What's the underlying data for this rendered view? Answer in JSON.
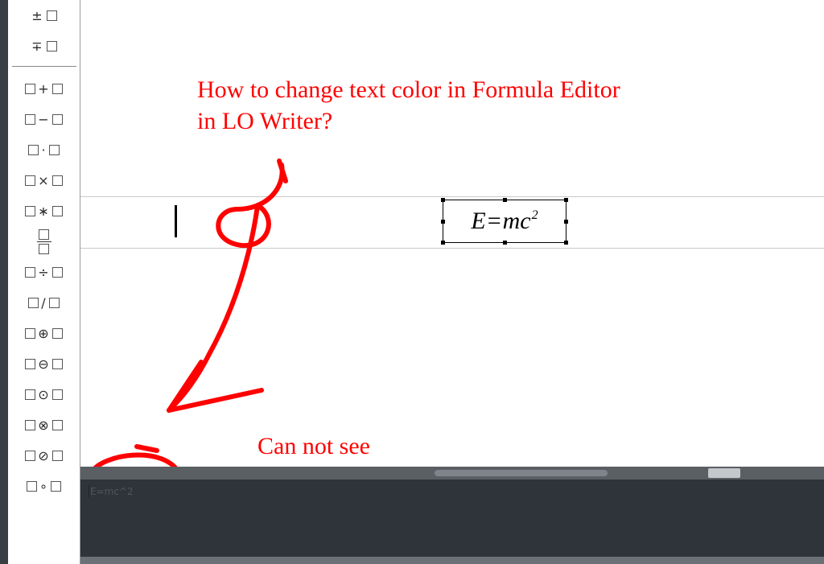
{
  "elements_panel": {
    "unary_ops": [
      {
        "name": "plus-minus",
        "symbol": "±"
      },
      {
        "name": "minus-plus",
        "symbol": "∓"
      }
    ],
    "binary_ops": [
      {
        "name": "addition",
        "symbol": "+"
      },
      {
        "name": "subtraction",
        "symbol": "−"
      },
      {
        "name": "multiplication-dot",
        "symbol": "·"
      },
      {
        "name": "multiplication-cross",
        "symbol": "×"
      },
      {
        "name": "multiplication-star",
        "symbol": "∗"
      },
      {
        "name": "fraction",
        "symbol": "frac"
      },
      {
        "name": "division",
        "symbol": "÷"
      },
      {
        "name": "division-slash",
        "symbol": "/"
      },
      {
        "name": "circled-plus",
        "symbol": "⊕"
      },
      {
        "name": "circled-minus",
        "symbol": "⊖"
      },
      {
        "name": "circled-dot",
        "symbol": "⊙"
      },
      {
        "name": "circled-times",
        "symbol": "⊗"
      },
      {
        "name": "circled-slash",
        "symbol": "⊘"
      },
      {
        "name": "small-circle",
        "symbol": "∘"
      }
    ]
  },
  "formula": {
    "rendered_E": "E",
    "rendered_eq": "=",
    "rendered_mc": "mc",
    "rendered_exp": "2"
  },
  "command_pane": {
    "text": "E=mc^2"
  },
  "annotations": {
    "question_line1": "How to change text color in Formula Editor",
    "question_line2": "in LO Writer?",
    "cannot_see": "Can not see"
  }
}
